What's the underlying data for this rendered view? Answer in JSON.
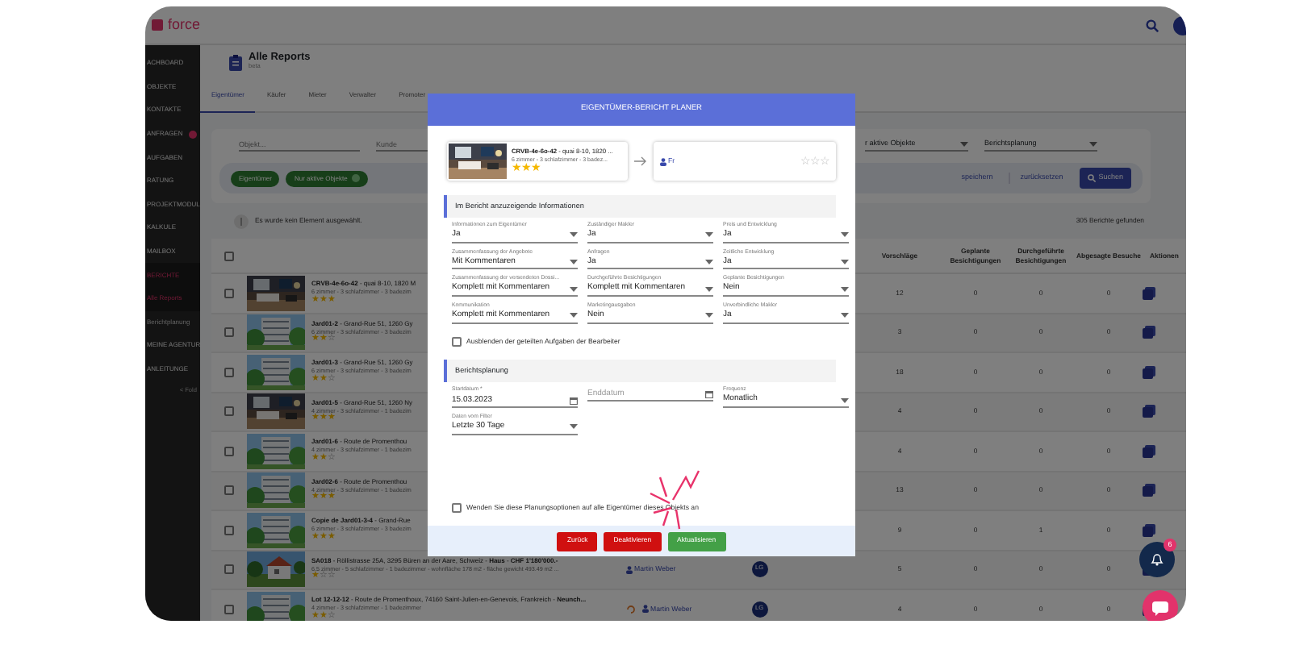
{
  "app": {
    "logo": "force"
  },
  "sidebar": {
    "items": [
      {
        "label": "ACHBOARD",
        "kind": "section",
        "selected": false
      },
      {
        "label": "OBJEKTE",
        "kind": "section",
        "selected": false
      },
      {
        "label": "KONTAKTE",
        "kind": "section",
        "selected": false
      },
      {
        "label": "ANFRAGEN",
        "kind": "section",
        "selected": false,
        "badge": true
      },
      {
        "label": "AUFGABEN",
        "kind": "section",
        "selected": false
      },
      {
        "label": "RATUNG",
        "kind": "section",
        "selected": false
      },
      {
        "label": "PROJEKTMODUL",
        "kind": "section",
        "selected": false
      },
      {
        "label": "KALKULE",
        "kind": "section",
        "selected": false
      },
      {
        "label": "MAILBOX",
        "kind": "section",
        "selected": false
      },
      {
        "label": "BERICHTE",
        "kind": "section",
        "selected": true
      },
      {
        "label": "Alle Reports",
        "kind": "sub",
        "selected": true
      },
      {
        "label": "Berichtplanung",
        "kind": "sub",
        "selected": false
      },
      {
        "label": "MEINE AGENTUR",
        "kind": "section",
        "selected": false
      },
      {
        "label": "ANLEITUNGE",
        "kind": "section",
        "selected": false
      }
    ],
    "fold": "< Fold"
  },
  "page": {
    "title": "Alle Reports",
    "subtitle": "beta"
  },
  "tabs": [
    {
      "label": "Eigentümer",
      "selected": true
    },
    {
      "label": "Käufer",
      "selected": false
    },
    {
      "label": "Mieter",
      "selected": false
    },
    {
      "label": "Verwalter",
      "selected": false
    },
    {
      "label": "Promoter",
      "selected": false
    }
  ],
  "filters": {
    "object_placeholder": "Objekt...",
    "client_placeholder": "Kunde",
    "status_select": "r aktive Objekte",
    "planning_select": "Berichtsplanung",
    "chips": [
      {
        "label": "Eigentümer",
        "removable": false
      },
      {
        "label": "Nur aktive Objekte",
        "removable": true
      }
    ],
    "save": "speichern",
    "reset": "zurücksetzen",
    "search": "Suchen"
  },
  "info": "Es wurde kein Element ausgewählt.",
  "result_count": "305 Berichte gefunden",
  "table": {
    "select_all_checked": false,
    "columns": [
      "Vorschläge",
      "Geplante Besichtigungen",
      "Durchgeführte Besichtigungen",
      "Abgesagte Besuche",
      "Aktionen"
    ],
    "rows": [
      {
        "checked": false,
        "title": "**CRVB-4e-6o-42** - quai 8-10, 1820 M",
        "details": "6 zimmer - 3 schlafzimmer - 3 badezim",
        "stars": 3,
        "values": [
          "12",
          "0",
          "0",
          "0"
        ]
      },
      {
        "checked": false,
        "title": "**Jard01-2** - Grand-Rue 51, 1260 Gy",
        "details": "6 zimmer - 3 schlafzimmer - 3 badezim",
        "stars": 2,
        "values": [
          "3",
          "0",
          "0",
          "0"
        ]
      },
      {
        "checked": false,
        "title": "**Jard01-3** - Grand-Rue 51, 1260 Gy",
        "details": "6 zimmer - 3 schlafzimmer - 3 badezim",
        "stars": 2,
        "values": [
          "18",
          "0",
          "0",
          "0"
        ]
      },
      {
        "checked": false,
        "title": "**Jard01-5** - Grand-Rue 51, 1260 Ny",
        "details": "4 zimmer - 3 schlafzimmer - 1 badezim",
        "stars": 3,
        "values": [
          "4",
          "0",
          "0",
          "0"
        ]
      },
      {
        "checked": false,
        "title": "**Jard01-6** - Route de Promenthou",
        "details": "4 zimmer - 3 schlafzimmer - 1 badezim",
        "stars": 2,
        "values": [
          "4",
          "0",
          "0",
          "0"
        ]
      },
      {
        "checked": false,
        "title": "**Jard02-6** - Route de Promenthou",
        "details": "4 zimmer - 3 schlafzimmer - 1 badezim",
        "stars": 3,
        "values": [
          "13",
          "0",
          "0",
          "0"
        ]
      },
      {
        "checked": false,
        "title": "**Copie de Jard01-3-4** - Grand-Rue",
        "details": "6 zimmer - 3 schlafzimmer - 3 badezim",
        "stars": 3,
        "values": [
          "9",
          "0",
          "1",
          "0"
        ]
      },
      {
        "checked": false,
        "title": "**SA018** - Röllistrasse 25A, 3295 Büren an der Aare, Schweiz - **Haus** - **CHF 1'180'000.-**",
        "details": "6.5 zimmer - 5 schlafzimmer - 1 badezimmer - wohnfläche 178 m2 - fläche gewicht 493.49 m2 ...",
        "stars": 1,
        "agent": "Martin Weber",
        "avatar": "LG",
        "values": [
          "5",
          "0",
          "0",
          "0"
        ]
      },
      {
        "checked": false,
        "title": "**Lot 12-12-12** - Route de Promenthoux, 74160 Saint-Julien-en-Genevois, Frankreich - **Neunch...**",
        "details": "4 zimmer - 3 schlafzimmer - 1 badezimmer",
        "stars": 2,
        "agent": "Martin Weber",
        "avatar": "LG",
        "status_icon": true,
        "values": [
          "4",
          "0",
          "0",
          "0"
        ]
      }
    ]
  },
  "modal": {
    "title": "EIGENTÜMER-BERICHT PLANER",
    "property": {
      "title": "**CRVB-4e-6o-42** - quai 8-10, 1820 ...",
      "details": "6 zimmer - 3 schlafzimmer - 3 badez...",
      "stars": 3
    },
    "owner": {
      "name": "Fr",
      "stars": 0
    },
    "sections": [
      {
        "title": "Im Bericht anzuzeigende Informationen",
        "fields": [
          {
            "kind": "select",
            "label": "Informationen zum Eigentümer",
            "value": "Ja"
          },
          {
            "kind": "select",
            "label": "Zuständiger Makler",
            "value": "Ja"
          },
          {
            "kind": "select",
            "label": "Preis und Entwicklung",
            "value": "Ja"
          },
          {
            "kind": "select",
            "label": "Zusammenfassung der Angebote",
            "value": "Mit Kommentaren"
          },
          {
            "kind": "select",
            "label": "Anfragen",
            "value": "Ja"
          },
          {
            "kind": "select",
            "label": "Zeitliche Entwicklung",
            "value": "Ja"
          },
          {
            "kind": "select",
            "label": "Zusammenfassung der versendeten Dossi...",
            "value": "Komplett mit Kommentaren"
          },
          {
            "kind": "select",
            "label": "Durchgeführte Besichtigungen",
            "value": "Komplett mit Kommentaren"
          },
          {
            "kind": "select",
            "label": "Geplante Besichtigungen",
            "value": "Nein"
          },
          {
            "kind": "select",
            "label": "Kommunikation",
            "value": "Komplett mit Kommentaren"
          },
          {
            "kind": "select",
            "label": "Marketingausgaben",
            "value": "Nein"
          },
          {
            "kind": "select",
            "label": "Unverbindliche Makler",
            "value": "Ja"
          }
        ],
        "checkbox": {
          "label": "Ausblenden der geteilten Aufgaben der Bearbeiter",
          "checked": false
        }
      },
      {
        "title": "Berichtsplanung",
        "fields": [
          {
            "kind": "date",
            "label": "Startdatum *",
            "value": "15.03.2023"
          },
          {
            "kind": "date",
            "placeholder": "Enddatum"
          },
          {
            "kind": "select",
            "label": "Frequenz",
            "value": "Monatlich"
          },
          {
            "kind": "select",
            "label": "Daten vom Filter",
            "value": "Letzte 30 Tage"
          }
        ]
      }
    ],
    "apply_all": {
      "label": "Wenden Sie diese Planungsoptionen auf alle Eigentümer dieses Objekts an",
      "checked": false
    },
    "buttons": [
      {
        "label": "Zurück",
        "kind": "danger"
      },
      {
        "label": "Deaktivieren",
        "kind": "danger"
      },
      {
        "label": "Aktualisieren",
        "kind": "success"
      }
    ]
  },
  "notifications": {
    "count": "6"
  }
}
